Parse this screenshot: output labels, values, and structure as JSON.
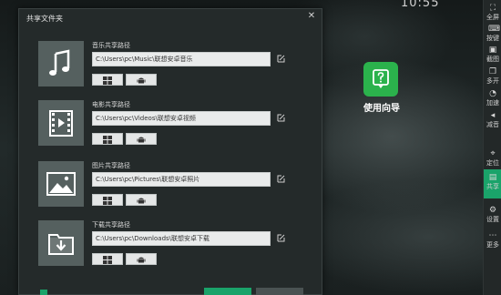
{
  "topbar": {
    "clock": "10:55"
  },
  "dialog": {
    "title": "共享文件夹",
    "close_glyph": "✕",
    "sections": [
      {
        "label": "音乐共享路径",
        "path": "C:\\Users\\pc\\Music\\联想安卓音乐",
        "icon": "music-note-icon"
      },
      {
        "label": "电影共享路径",
        "path": "C:\\Users\\pc\\Videos\\联想安卓视频",
        "icon": "film-icon"
      },
      {
        "label": "图片共享路径",
        "path": "C:\\Users\\pc\\Pictures\\联想安卓照片",
        "icon": "image-icon"
      },
      {
        "label": "下载共享路径",
        "path": "C:\\Users\\pc\\Downloads\\联想安卓下载",
        "icon": "download-folder-icon"
      }
    ],
    "buttons": {
      "windows_icon": "windows-icon",
      "android_icon": "android-icon"
    }
  },
  "desktop": {
    "icon_label": "使用向导",
    "icon_color": "#2bb24c"
  },
  "sidebar": {
    "accent_color": "#1aa36a",
    "items": [
      {
        "label": "全屏",
        "icon": "fullscreen-icon"
      },
      {
        "label": "按键",
        "icon": "keyboard-icon"
      },
      {
        "label": "截图",
        "icon": "screenshot-icon"
      },
      {
        "label": "多开",
        "icon": "multi-instance-icon"
      },
      {
        "label": "加速",
        "icon": "speed-icon"
      },
      {
        "label": "减音",
        "icon": "volume-icon"
      },
      {
        "label": "定位",
        "icon": "location-icon"
      },
      {
        "label": "共享",
        "icon": "share-folder-icon"
      },
      {
        "label": "设置",
        "icon": "gear-icon"
      },
      {
        "label": "更多",
        "icon": "more-icon"
      }
    ]
  }
}
